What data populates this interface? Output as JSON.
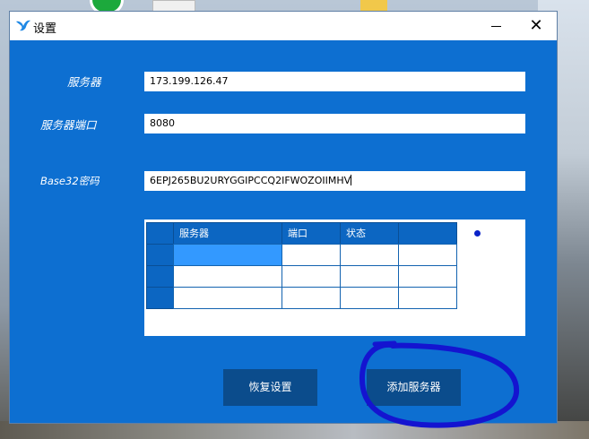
{
  "window": {
    "title": "设置"
  },
  "form": {
    "server_label": "服务器",
    "server_value": "173.199.126.47",
    "port_label": "服务器端口",
    "port_value": "8080",
    "secret_label": "Base32密码",
    "secret_value": "6EPJ265BU2URYGGIPCCQ2IFWOZOIIMHV"
  },
  "table": {
    "columns": [
      "服务器",
      "端口",
      "状态",
      ""
    ],
    "rows": [
      [
        "",
        "",
        "",
        ""
      ],
      [
        "",
        "",
        "",
        ""
      ],
      [
        "",
        "",
        "",
        ""
      ]
    ]
  },
  "buttons": {
    "restore": "恢复设置",
    "add_server": "添加服务器"
  },
  "annotation": {
    "color": "#1414d0"
  }
}
